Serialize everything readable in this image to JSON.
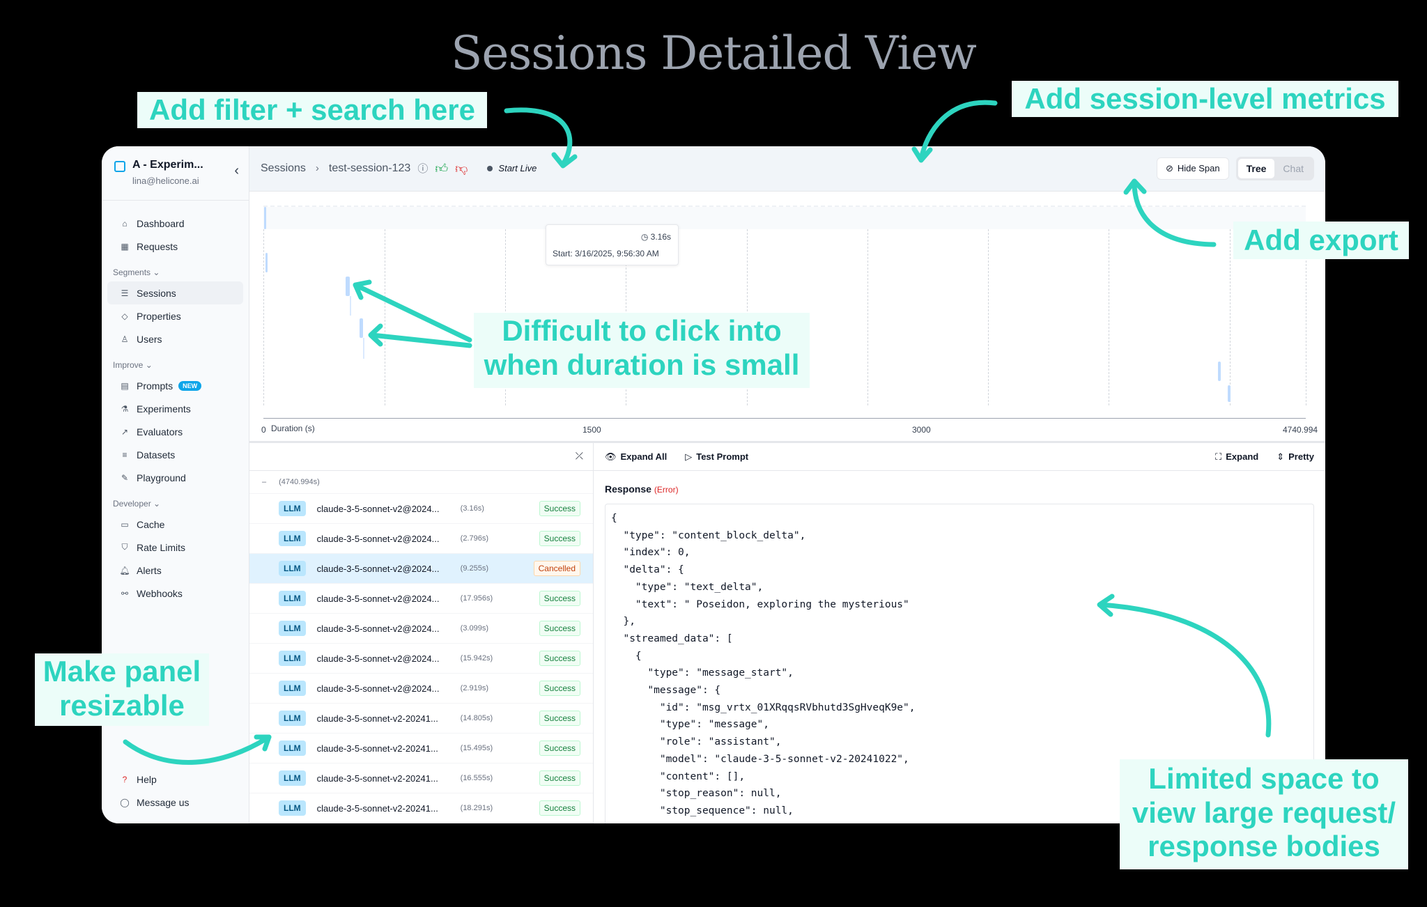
{
  "page": {
    "title": "Sessions Detailed View"
  },
  "sidebar": {
    "org_name": "A - Experim...",
    "org_email": "lina@helicone.ai",
    "top_items": [
      {
        "label": "Dashboard",
        "icon": "home-icon"
      },
      {
        "label": "Requests",
        "icon": "table-icon"
      }
    ],
    "segments_label": "Segments",
    "segment_items": [
      {
        "label": "Sessions"
      },
      {
        "label": "Properties"
      },
      {
        "label": "Users"
      }
    ],
    "improve_label": "Improve",
    "improve_items": [
      {
        "label": "Prompts",
        "badge": "NEW"
      },
      {
        "label": "Experiments"
      },
      {
        "label": "Evaluators"
      },
      {
        "label": "Datasets"
      },
      {
        "label": "Playground"
      }
    ],
    "developer_label": "Developer",
    "developer_items": [
      {
        "label": "Cache"
      },
      {
        "label": "Rate Limits"
      },
      {
        "label": "Alerts"
      },
      {
        "label": "Webhooks"
      }
    ],
    "help": "Help",
    "message": "Message us"
  },
  "topbar": {
    "breadcrumb_root": "Sessions",
    "breadcrumb_session": "test-session-123",
    "live_label": "Start Live",
    "hide_span": "Hide Span",
    "view_tree": "Tree",
    "view_chat": "Chat"
  },
  "timeline": {
    "tooltip_duration": "3.16s",
    "tooltip_start": "Start: 3/16/2025, 9:56:30 AM",
    "axis_label": "Duration (s)",
    "ticks": [
      "0",
      "1500",
      "3000",
      "4740.994"
    ]
  },
  "list": {
    "root_duration": "(4740.994s)",
    "rows": [
      {
        "type": "LLM",
        "model": "claude-3-5-sonnet-v2@2024...",
        "duration": "(3.16s)",
        "status": "Success"
      },
      {
        "type": "LLM",
        "model": "claude-3-5-sonnet-v2@2024...",
        "duration": "(2.796s)",
        "status": "Success"
      },
      {
        "type": "LLM",
        "model": "claude-3-5-sonnet-v2@2024...",
        "duration": "(9.255s)",
        "status": "Cancelled"
      },
      {
        "type": "LLM",
        "model": "claude-3-5-sonnet-v2@2024...",
        "duration": "(17.956s)",
        "status": "Success"
      },
      {
        "type": "LLM",
        "model": "claude-3-5-sonnet-v2@2024...",
        "duration": "(3.099s)",
        "status": "Success"
      },
      {
        "type": "LLM",
        "model": "claude-3-5-sonnet-v2@2024...",
        "duration": "(15.942s)",
        "status": "Success"
      },
      {
        "type": "LLM",
        "model": "claude-3-5-sonnet-v2@2024...",
        "duration": "(2.919s)",
        "status": "Success"
      },
      {
        "type": "LLM",
        "model": "claude-3-5-sonnet-v2-20241...",
        "duration": "(14.805s)",
        "status": "Success"
      },
      {
        "type": "LLM",
        "model": "claude-3-5-sonnet-v2-20241...",
        "duration": "(15.495s)",
        "status": "Success"
      },
      {
        "type": "LLM",
        "model": "claude-3-5-sonnet-v2-20241...",
        "duration": "(16.555s)",
        "status": "Success"
      },
      {
        "type": "LLM",
        "model": "claude-3-5-sonnet-v2-20241...",
        "duration": "(18.291s)",
        "status": "Success"
      }
    ]
  },
  "response": {
    "expand_all": "Expand All",
    "test_prompt": "Test Prompt",
    "expand": "Expand",
    "pretty": "Pretty",
    "title": "Response",
    "error_tag": "(Error)",
    "body": "{\n  \"type\": \"content_block_delta\",\n  \"index\": 0,\n  \"delta\": {\n    \"type\": \"text_delta\",\n    \"text\": \" Poseidon, exploring the mysterious\"\n  },\n  \"streamed_data\": [\n    {\n      \"type\": \"message_start\",\n      \"message\": {\n        \"id\": \"msg_vrtx_01XRqqsRVbhutd3SgHveqK9e\",\n        \"type\": \"message\",\n        \"role\": \"assistant\",\n        \"model\": \"claude-3-5-sonnet-v2-20241022\",\n        \"content\": [],\n        \"stop_reason\": null,\n        \"stop_sequence\": null,"
  },
  "annotations": {
    "filter_search": "Add filter + search here",
    "session_metrics": "Add session-level metrics",
    "export": "Add export",
    "difficult_click_1": "Difficult to click into",
    "difficult_click_2": "when duration is small",
    "resizable_1": "Make panel",
    "resizable_2": "resizable",
    "limited_space_1": "Limited space to",
    "limited_space_2": "view large request/",
    "limited_space_3": "response bodies"
  }
}
